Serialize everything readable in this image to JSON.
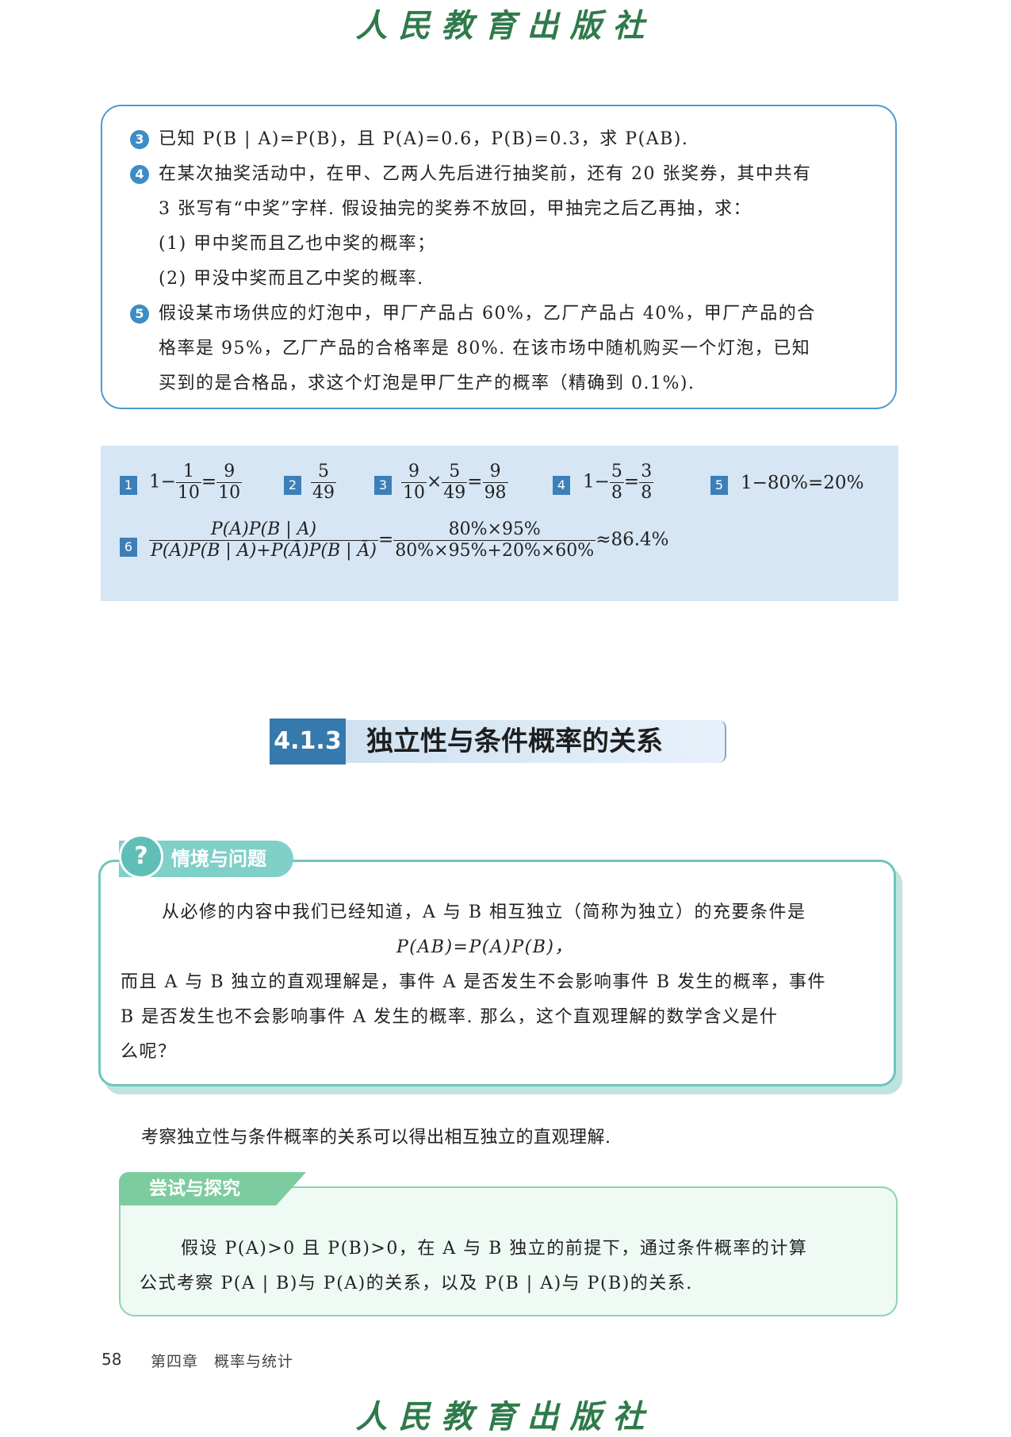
{
  "header": {
    "publisher": "人民教育出版社"
  },
  "exercises": {
    "q3": {
      "num": "3",
      "text": "已知 P(B | A)=P(B)，且 P(A)=0.6，P(B)=0.3，求 P(AB)."
    },
    "q4": {
      "num": "4",
      "line1": "在某次抽奖活动中，在甲、乙两人先后进行抽奖前，还有 20 张奖券，其中共有",
      "line2": "3 张写有“中奖”字样. 假设抽完的奖券不放回，甲抽完之后乙再抽，求：",
      "sub1": "(1) 甲中奖而且乙也中奖的概率；",
      "sub2": "(2) 甲没中奖而且乙中奖的概率."
    },
    "q5": {
      "num": "5",
      "line1": "假设某市场供应的灯泡中，甲厂产品占 60%，乙厂产品占 40%，甲厂产品的合",
      "line2": "格率是 95%，乙厂产品的合格率是 80%. 在该市场中随机购买一个灯泡，已知",
      "line3": "买到的是合格品，求这个灯泡是甲厂生产的概率（精确到 0.1%)."
    }
  },
  "answers": {
    "a1": {
      "num": "1",
      "pre": "1−",
      "f1n": "1",
      "f1d": "10",
      "eq": "=",
      "f2n": "9",
      "f2d": "10"
    },
    "a2": {
      "num": "2",
      "fn": "5",
      "fd": "49"
    },
    "a3": {
      "num": "3",
      "f1n": "9",
      "f1d": "10",
      "times": "×",
      "f2n": "5",
      "f2d": "49",
      "eq": "=",
      "f3n": "9",
      "f3d": "98"
    },
    "a4": {
      "num": "4",
      "pre": "1−",
      "f1n": "5",
      "f1d": "8",
      "eq": "=",
      "f2n": "3",
      "f2d": "8"
    },
    "a5": {
      "num": "5",
      "text": "1−80%=20%"
    },
    "a6": {
      "num": "6",
      "n1": "P(A)P(B | A)",
      "d1": "P(A)P(B | A)+P(Ā)P(B | Ā)",
      "eq": "=",
      "n2": "80%×95%",
      "d2": "80%×95%+20%×60%",
      "result": "≈86.4%"
    }
  },
  "section": {
    "number": "4.1.3",
    "title": "独立性与条件概率的关系"
  },
  "scenario": {
    "label": "情境与问题",
    "icon": "?",
    "line1": "从必修的内容中我们已经知道，A 与 B 相互独立（简称为独立）的充要条件是",
    "formula": "P(AB)=P(A)P(B)，",
    "line2": "而且 A 与 B 独立的直观理解是，事件 A 是否发生不会影响事件 B 发生的概率，事件",
    "line3": "B 是否发生也不会影响事件 A 发生的概率. 那么，这个直观理解的数学含义是什",
    "line4": "么呢？"
  },
  "body_text": "考察独立性与条件概率的关系可以得出相互独立的直观理解.",
  "explore": {
    "label": "尝试与探究",
    "line1": "假设 P(A)>0 且 P(B)>0，在 A 与 B 独立的前提下，通过条件概率的计算",
    "line2": "公式考察 P(A | B)与 P(A)的关系，以及 P(B | A)与 P(B)的关系."
  },
  "footer": {
    "page": "58",
    "chapter": "第四章　概率与统计",
    "publisher": "人民教育出版社"
  }
}
